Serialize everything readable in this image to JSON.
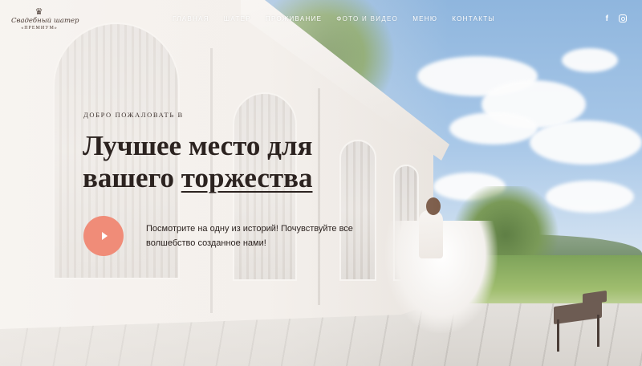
{
  "brand": {
    "crown": "♛",
    "line1": "Свадебный шатер",
    "line2": "«ПРЕМИУМ»"
  },
  "nav": {
    "items": [
      {
        "label": "ГЛАВНАЯ"
      },
      {
        "label": "ШАТЕР"
      },
      {
        "label": "ПРОЖИВАНИЕ"
      },
      {
        "label": "ФОТО И ВИДЕО"
      },
      {
        "label": "МЕНЮ"
      },
      {
        "label": "КОНТАКТЫ"
      }
    ]
  },
  "social": {
    "facebook_icon": "facebook-icon",
    "facebook_glyph": "f",
    "instagram_icon": "instagram-icon"
  },
  "hero": {
    "welcome": "ДОБРО ПОЖАЛОВАТЬ В",
    "headline_line1": "Лучшее место для",
    "headline_prefix": "вашего ",
    "headline_highlight": "торжества",
    "play_icon": "play-icon",
    "invite": "Посмотрите на одну из историй! Почувствуйте все волшебство созданное нами!"
  },
  "colors": {
    "accent": "#f08c78",
    "text": "#2c2320",
    "nav_text": "#ffffff"
  }
}
